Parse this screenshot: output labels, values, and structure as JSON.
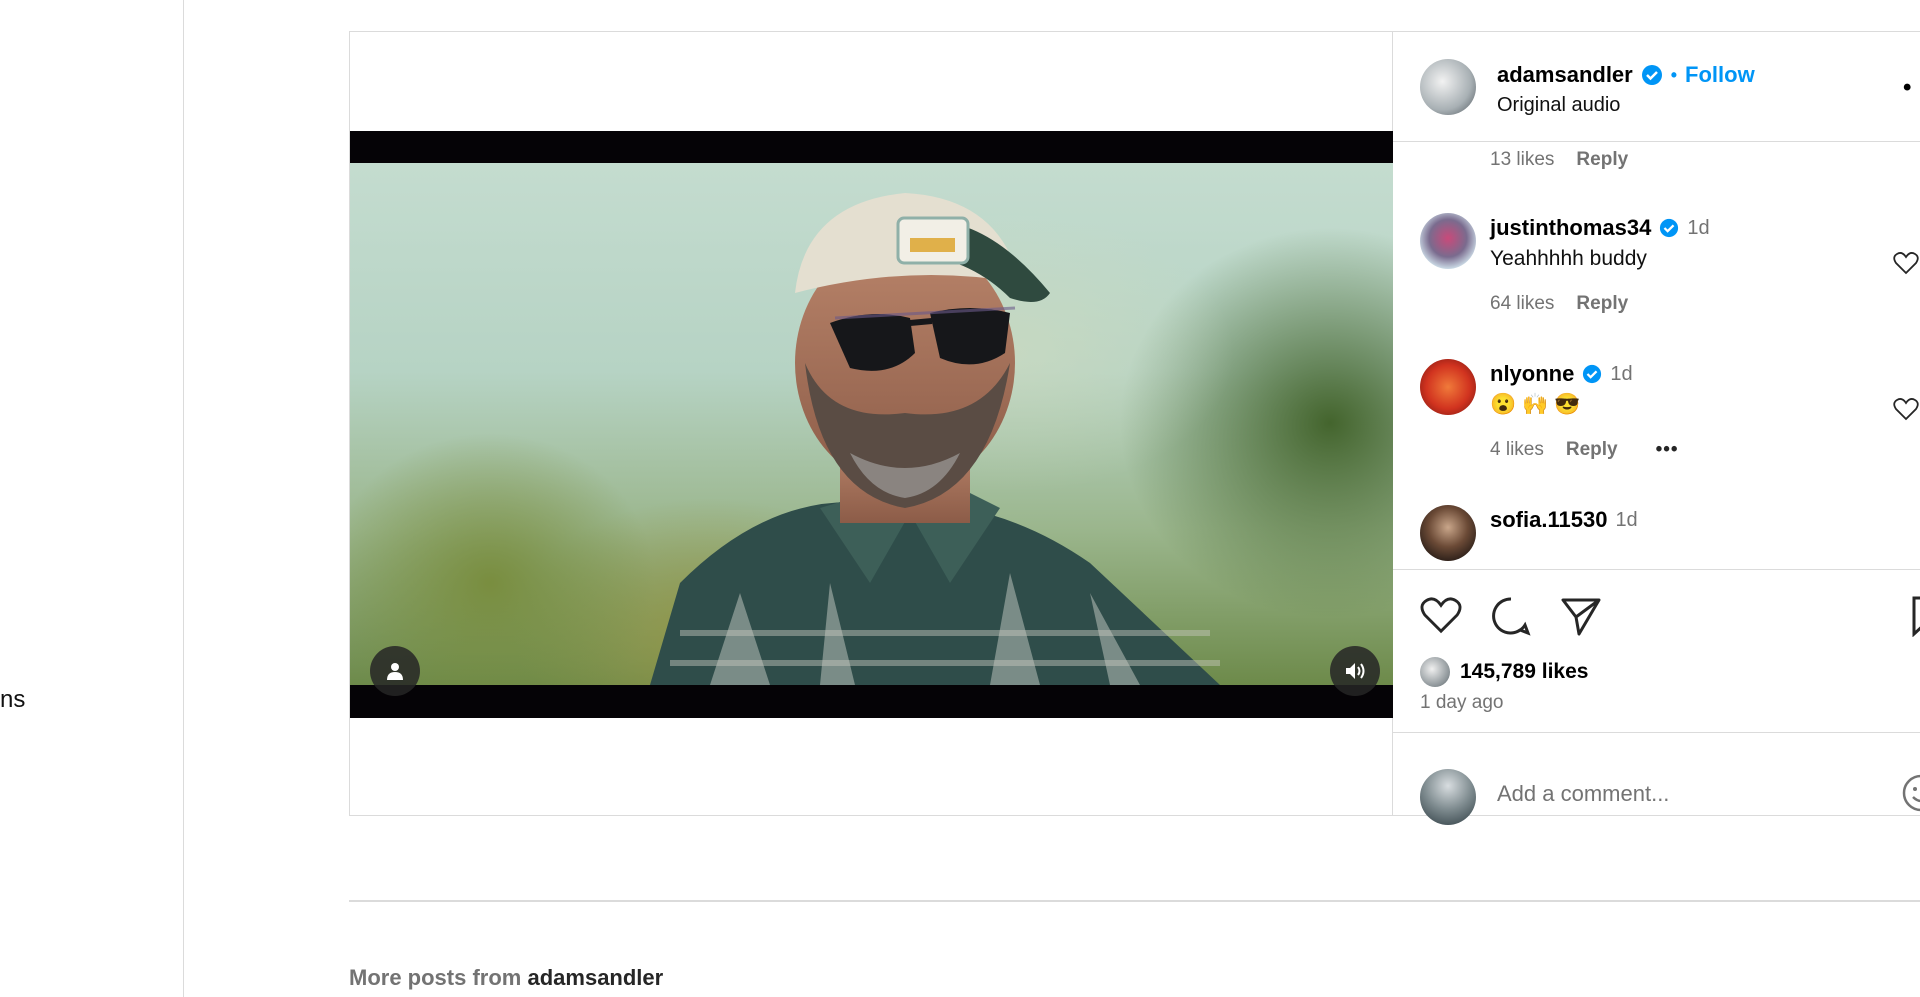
{
  "nav": {
    "fragment_label": "ns"
  },
  "post": {
    "owner": {
      "username": "adamsandler",
      "follow_label": "Follow",
      "separator": "•",
      "audio": "Original audio"
    },
    "prev_comment_meta": {
      "likes": "13 likes",
      "reply": "Reply"
    },
    "comments": [
      {
        "username": "justinthomas34",
        "verified": true,
        "time": "1d",
        "text": "Yeahhhhh buddy",
        "likes": "64 likes",
        "reply": "Reply"
      },
      {
        "username": "nlyonne",
        "verified": true,
        "time": "1d",
        "text": "😮 🙌 😎",
        "likes": "4 likes",
        "reply": "Reply",
        "more": "•••"
      },
      {
        "username": "sofia.11530",
        "verified": false,
        "time": "1d",
        "text": ""
      }
    ],
    "likes_count": "145,789 likes",
    "posted_ago": "1 day ago",
    "comment_placeholder": "Add a comment...",
    "more_menu": "•"
  },
  "more_posts": {
    "prefix": "More posts from",
    "username": "adamsandler"
  },
  "colors": {
    "accent": "#0095f6",
    "border": "#dbdbdb",
    "muted": "#737373"
  }
}
